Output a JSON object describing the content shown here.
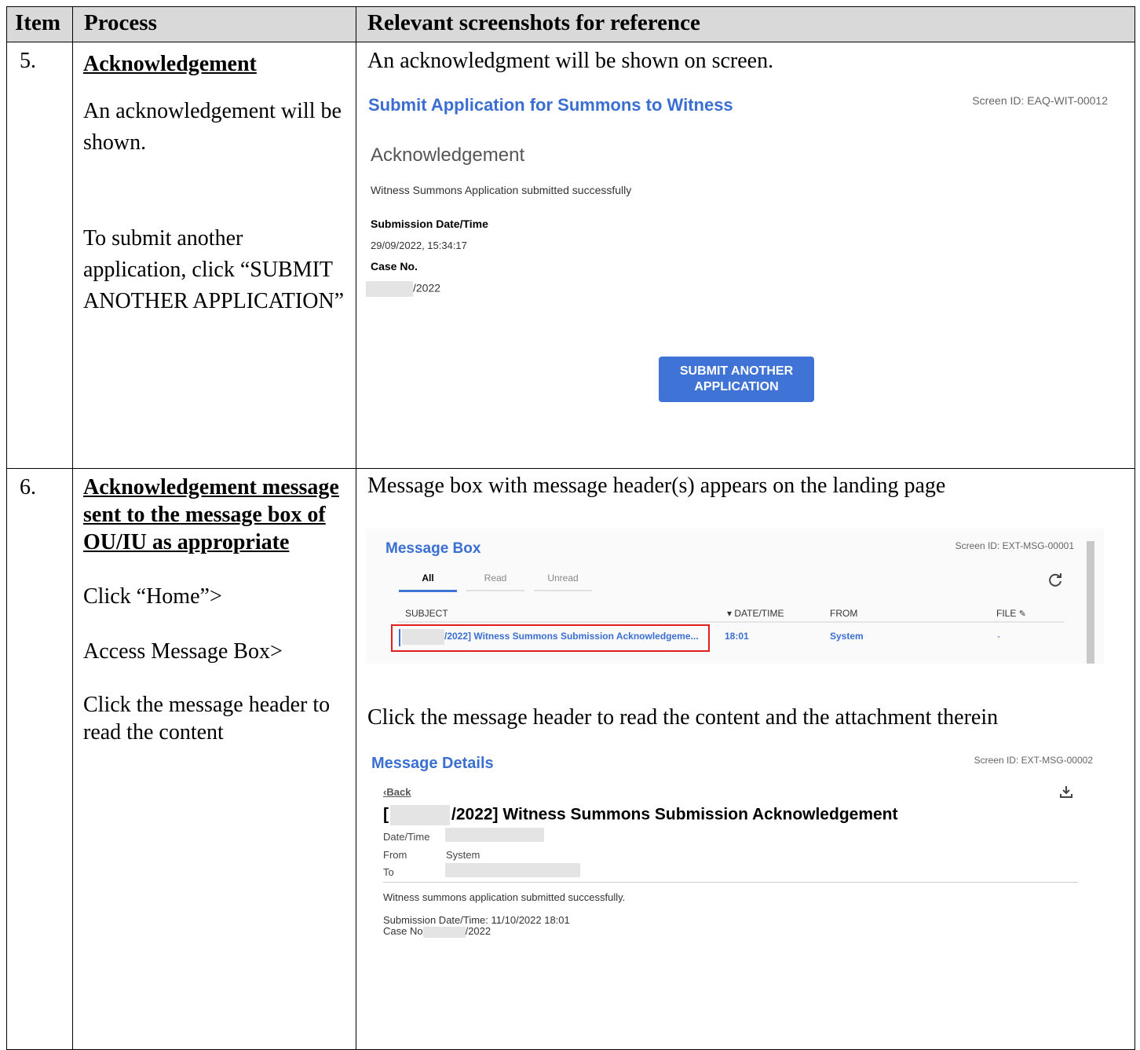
{
  "header": {
    "item": "Item",
    "process": "Process",
    "screens": "Relevant screenshots for reference"
  },
  "row5": {
    "item": "5.",
    "title": "Acknowledgement",
    "desc1": "An acknowledgement will be shown.",
    "desc2": "To submit another application, click “SUBMIT ANOTHER APPLICATION”",
    "caption": "An acknowledgment will be shown on screen.",
    "screen": {
      "title": "Submit Application for Summons to Witness",
      "screen_id": "Screen ID: EAQ-WIT-00012",
      "heading": "Acknowledgement",
      "message": "Witness Summons Application submitted successfully",
      "date_label": "Submission Date/Time",
      "date_value": "29/09/2022, 15:34:17",
      "case_label": "Case No.",
      "case_value": "/2022",
      "button": "SUBMIT ANOTHER APPLICATION"
    }
  },
  "row6": {
    "item": "6.",
    "title": "Acknowledgement message sent to the message box of OU/IU as appropriate",
    "step1": "Click “Home”>",
    "step2": "Access Message Box>",
    "step3": "Click the message header to read the content",
    "caption1": "Message box with message header(s) appears on the landing page",
    "caption2": "Click the message header to read the content and the attachment therein",
    "msgbox": {
      "title": "Message Box",
      "screen_id": "Screen ID: EXT-MSG-00001",
      "tabs": [
        "All",
        "Read",
        "Unread"
      ],
      "col_subject": "SUBJECT",
      "col_date": "▾ DATE/TIME",
      "col_from": "FROM",
      "col_file": "FILE",
      "row_subject": "/2022] Witness Summons Submission Acknowledgeme...",
      "row_time": "18:01",
      "row_from": "System",
      "row_file": "-"
    },
    "details": {
      "title": "Message Details",
      "screen_id": "Screen ID: EXT-MSG-00002",
      "back": "Back",
      "subject_prefix": "[",
      "subject": "/2022] Witness Summons Submission Acknowledgement",
      "date_label": "Date/Time",
      "from_label": "From",
      "from_value": "System",
      "to_label": "To",
      "body1": "Witness summons application submitted successfully.",
      "body2": "Submission Date/Time: 11/10/2022 18:01",
      "body3_label": "Case No",
      "body3_value": "/2022"
    }
  }
}
